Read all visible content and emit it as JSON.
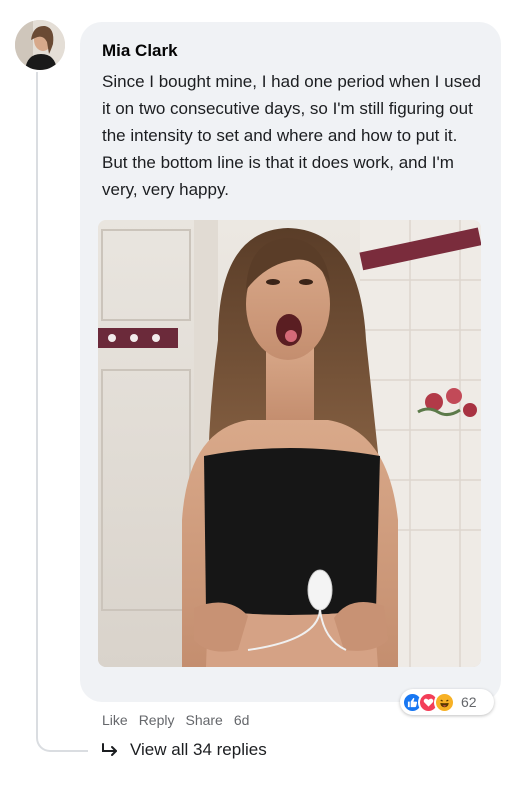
{
  "comment": {
    "author": "Mia Clark",
    "text": "Since I bought mine, I had one period when I used it on two consecutive days, so I'm still figuring out the intensity to set and where and how to put it. But the bottom line is that it does work, and I'm very, very happy.",
    "reaction_count": "62",
    "reactions": [
      "like-icon",
      "love-icon",
      "haha-icon"
    ],
    "actions": {
      "like": "Like",
      "reply": "Reply",
      "share": "Share",
      "time": "6d"
    }
  },
  "replies": {
    "label": "View all 34 replies"
  },
  "colors": {
    "bubble": "#f0f2f5",
    "thread_line": "#dadde1",
    "like_blue": "#1877f2",
    "love_red": "#f33e58",
    "haha_yellow": "#f7b125",
    "muted_text": "#65676b"
  }
}
